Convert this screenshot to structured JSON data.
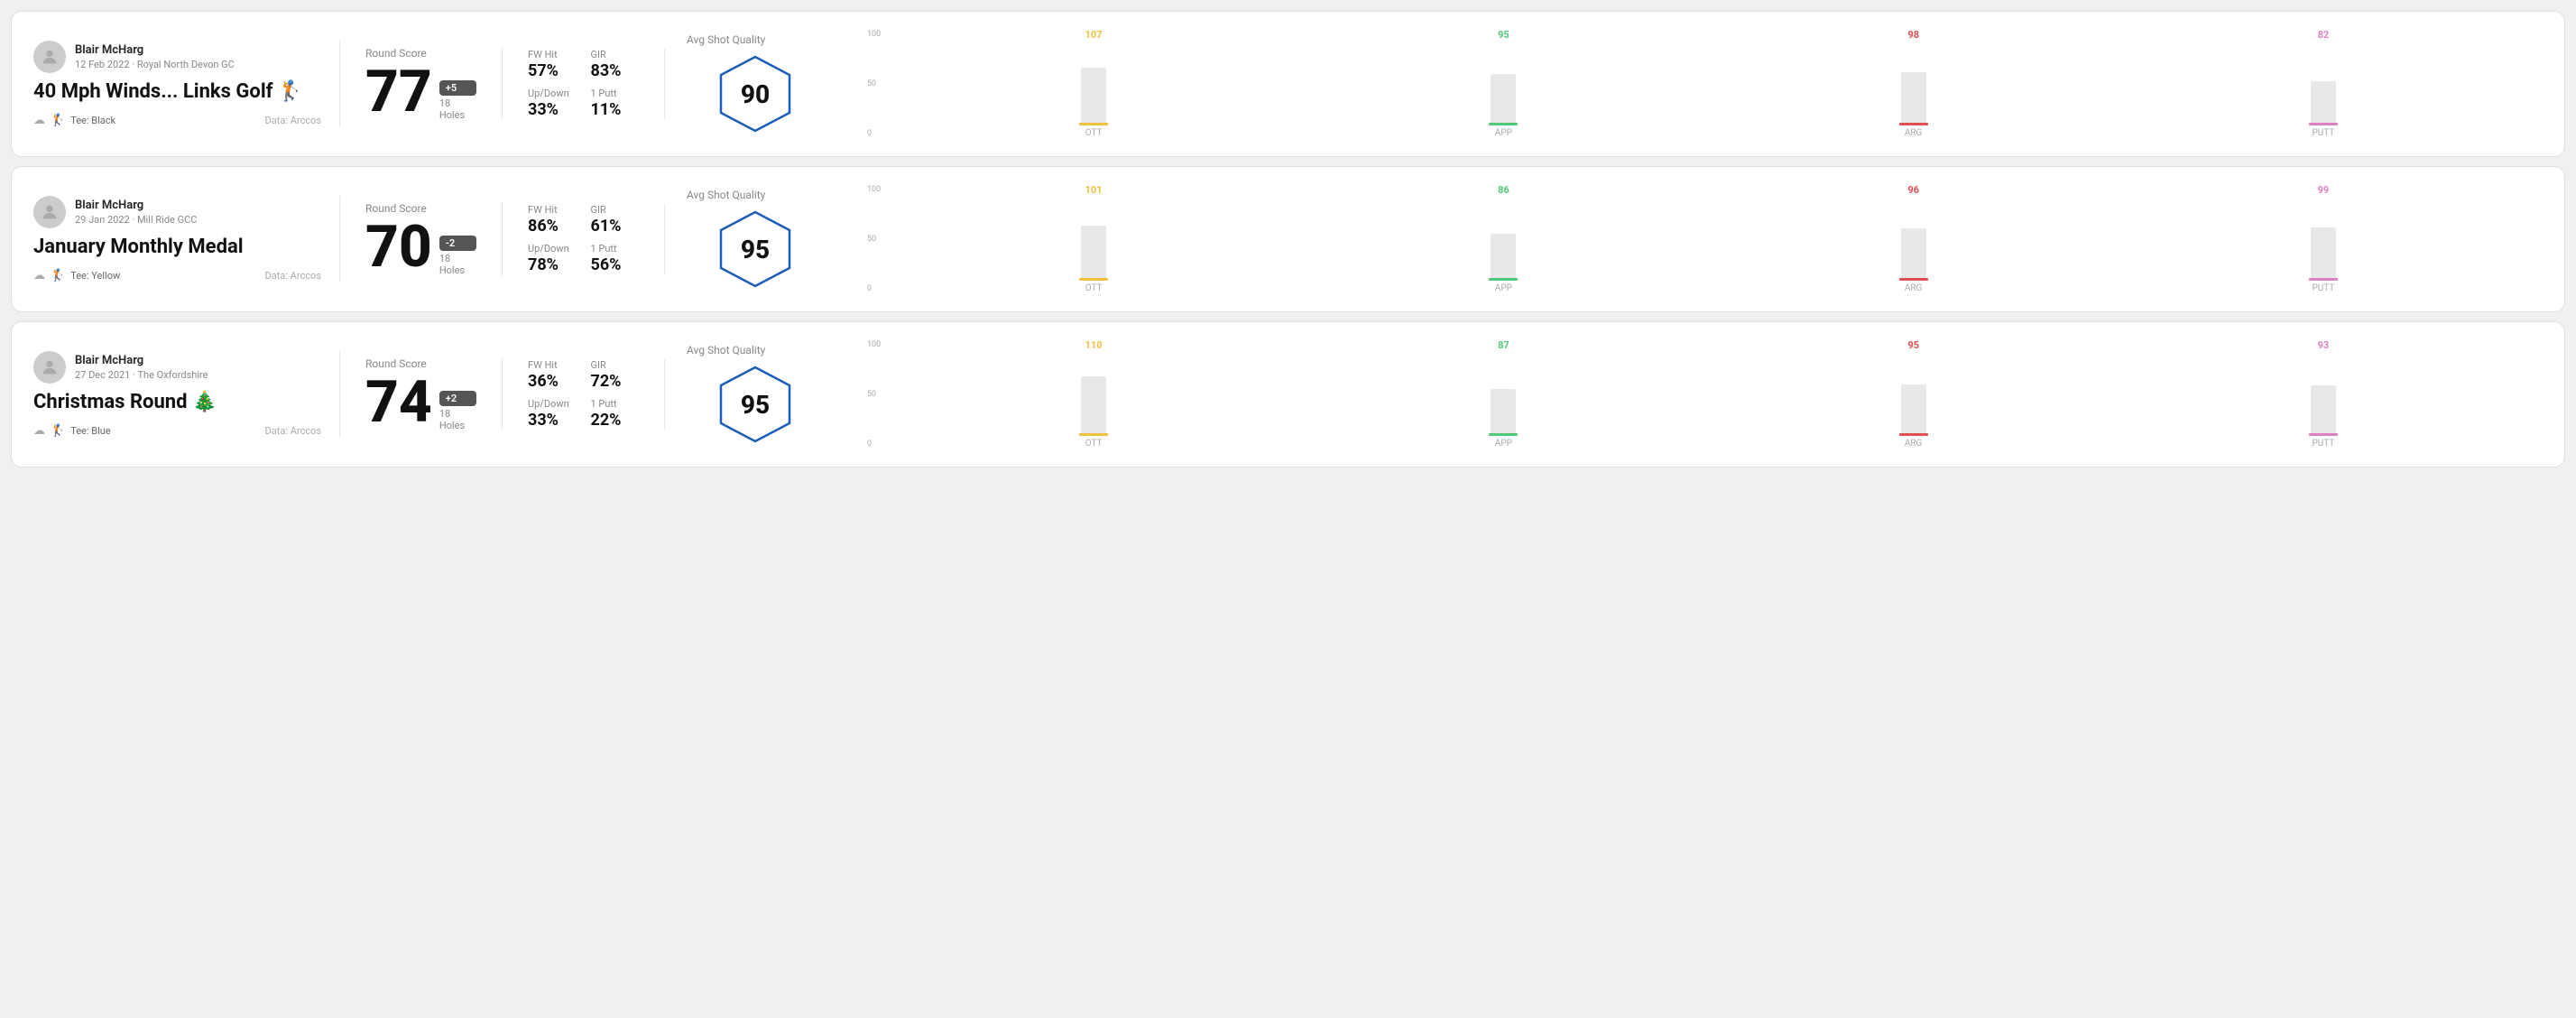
{
  "rounds": [
    {
      "id": "round1",
      "user": {
        "name": "Blair McHarg",
        "date_course": "12 Feb 2022 · Royal North Devon GC"
      },
      "title": "40 Mph Winds... Links Golf 🏌",
      "tee": "Black",
      "data_source": "Data: Arccos",
      "round_score_label": "Round Score",
      "score": "77",
      "badge": "+5",
      "holes": "18 Holes",
      "fw_hit_label": "FW Hit",
      "fw_hit": "57%",
      "gir_label": "GIR",
      "gir": "83%",
      "updown_label": "Up/Down",
      "updown": "33%",
      "oneputt_label": "1 Putt",
      "oneputt": "11%",
      "quality_label": "Avg Shot Quality",
      "quality_score": "90",
      "chart": {
        "columns": [
          {
            "label": "OTT",
            "value": 107,
            "color": "#f0c040"
          },
          {
            "label": "APP",
            "value": 95,
            "color": "#50c878"
          },
          {
            "label": "ARG",
            "value": 98,
            "color": "#e05050"
          },
          {
            "label": "PUTT",
            "value": 82,
            "color": "#e080c0"
          }
        ]
      }
    },
    {
      "id": "round2",
      "user": {
        "name": "Blair McHarg",
        "date_course": "29 Jan 2022 · Mill Ride GCC"
      },
      "title": "January Monthly Medal",
      "tee": "Yellow",
      "data_source": "Data: Arccos",
      "round_score_label": "Round Score",
      "score": "70",
      "badge": "-2",
      "holes": "18 Holes",
      "fw_hit_label": "FW Hit",
      "fw_hit": "86%",
      "gir_label": "GIR",
      "gir": "61%",
      "updown_label": "Up/Down",
      "updown": "78%",
      "oneputt_label": "1 Putt",
      "oneputt": "56%",
      "quality_label": "Avg Shot Quality",
      "quality_score": "95",
      "chart": {
        "columns": [
          {
            "label": "OTT",
            "value": 101,
            "color": "#f0c040"
          },
          {
            "label": "APP",
            "value": 86,
            "color": "#50c878"
          },
          {
            "label": "ARG",
            "value": 96,
            "color": "#e05050"
          },
          {
            "label": "PUTT",
            "value": 99,
            "color": "#e080c0"
          }
        ]
      }
    },
    {
      "id": "round3",
      "user": {
        "name": "Blair McHarg",
        "date_course": "27 Dec 2021 · The Oxfordshire"
      },
      "title": "Christmas Round 🎄",
      "tee": "Blue",
      "data_source": "Data: Arccos",
      "round_score_label": "Round Score",
      "score": "74",
      "badge": "+2",
      "holes": "18 Holes",
      "fw_hit_label": "FW Hit",
      "fw_hit": "36%",
      "gir_label": "GIR",
      "gir": "72%",
      "updown_label": "Up/Down",
      "updown": "33%",
      "oneputt_label": "1 Putt",
      "oneputt": "22%",
      "quality_label": "Avg Shot Quality",
      "quality_score": "95",
      "chart": {
        "columns": [
          {
            "label": "OTT",
            "value": 110,
            "color": "#f0c040"
          },
          {
            "label": "APP",
            "value": 87,
            "color": "#50c878"
          },
          {
            "label": "ARG",
            "value": 95,
            "color": "#e05050"
          },
          {
            "label": "PUTT",
            "value": 93,
            "color": "#e080c0"
          }
        ]
      }
    }
  ]
}
